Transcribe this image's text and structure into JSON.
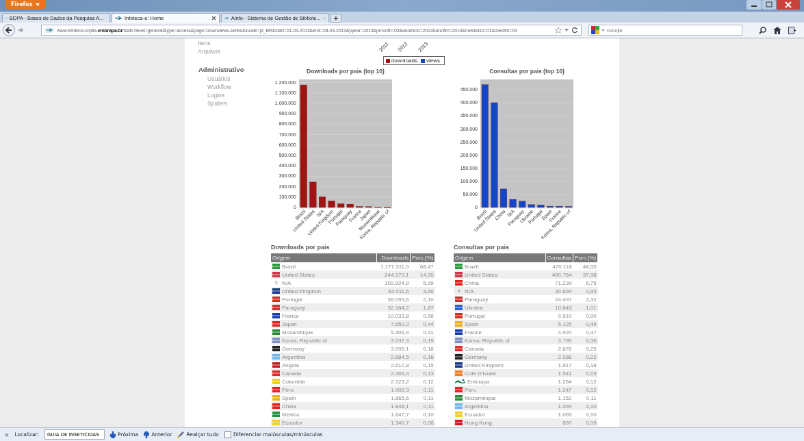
{
  "browser": {
    "menu_button": "Firefox",
    "tabs": [
      {
        "title": "BDPA - Bases de Dados da Pesquisa A...",
        "selected": false
      },
      {
        "title": "Infoteca-e: Home",
        "selected": true
      },
      {
        "title": "Ainfo - Sistema de Gestão de Bibliote...",
        "selected": false
      }
    ],
    "new_tab": "+",
    "url": "www.infoteca.cnptia.**embrapa.br**/stats?level=general&type=access&page=downviews-series&locale=pt_BR&start=01-03-2013&end=28-03-2013&pyear=2013&pmonth=03&anoinicio=2013&anofim=2013&mesinicio=01&mesfim=03",
    "search": {
      "placeholder": "Google"
    }
  },
  "sidebar": {
    "top_items": [
      "Itens",
      "Arquivos"
    ],
    "sections": [
      {
        "title": "Administrativo",
        "items": [
          "Usuários",
          "Workflow",
          "Logins",
          "Spiders"
        ]
      }
    ]
  },
  "timeline_labels": [
    "2011",
    "2012",
    "2013"
  ],
  "charts": [
    {
      "chart_data": {
        "type": "bar",
        "title": "Downloads por pais (top 10)",
        "categories": [
          "Brazil",
          "United States",
          "N/A",
          "United Kingdom",
          "Portugal",
          "Paraguay",
          "France",
          "Japan",
          "Mozambique",
          "Korea, Republic of"
        ],
        "series": [
          {
            "name": "downloads",
            "color": "#a01414",
            "values": [
              1177000,
              244000,
              103000,
              63000,
              36000,
              32000,
              10000,
              8000,
              5000,
              3000
            ]
          }
        ],
        "ylim": [
          0,
          1230000
        ],
        "grid": true,
        "yticks": [
          {
            "value": 0,
            "label": "0"
          },
          {
            "value": 100000,
            "label": "100.000"
          },
          {
            "value": 200000,
            "label": "200.000"
          },
          {
            "value": 300000,
            "label": "300.000"
          },
          {
            "value": 400000,
            "label": "400.000"
          },
          {
            "value": 500000,
            "label": "500.000"
          },
          {
            "value": 600000,
            "label": "600.000"
          },
          {
            "value": 700000,
            "label": "700.000"
          },
          {
            "value": 800000,
            "label": "800.000"
          },
          {
            "value": 900000,
            "label": "900.000"
          },
          {
            "value": 1000000,
            "label": "1.000.000"
          },
          {
            "value": 1100000,
            "label": "1.100.000"
          },
          {
            "value": 1200000,
            "label": "1.200.000"
          }
        ]
      }
    },
    {
      "chart_data": {
        "type": "bar",
        "title": "Consultas por pais (top 10)",
        "categories": [
          "Brazil",
          "United States",
          "China",
          "N/A",
          "Paraguay",
          "Ukraine",
          "Portugal",
          "Spain",
          "France",
          "Korea, Republic of"
        ],
        "series": [
          {
            "name": "views",
            "color": "#1446c8",
            "values": [
              470000,
              401000,
              71000,
              31000,
              24000,
              11000,
              10000,
              5000,
              5000,
              4000
            ]
          }
        ],
        "ylim": [
          0,
          490000
        ],
        "grid": true,
        "yticks": [
          {
            "value": 0,
            "label": "0"
          },
          {
            "value": 50000,
            "label": "50.000"
          },
          {
            "value": 100000,
            "label": "100.000"
          },
          {
            "value": 150000,
            "label": "150.000"
          },
          {
            "value": 200000,
            "label": "200.000"
          },
          {
            "value": 250000,
            "label": "250.000"
          },
          {
            "value": 300000,
            "label": "300.000"
          },
          {
            "value": 350000,
            "label": "350.000"
          },
          {
            "value": 400000,
            "label": "400.000"
          },
          {
            "value": 450000,
            "label": "450.000"
          }
        ]
      }
    }
  ],
  "tables": [
    {
      "title": "Downloads por pais",
      "columns": [
        "Origem",
        "Downloads",
        "Porc.(%)"
      ],
      "rows": [
        {
          "kind": "flag",
          "color": "#2a9a3a",
          "country": "Brazil",
          "value": "1.177.311,5",
          "percent": "68,47"
        },
        {
          "kind": "flag",
          "color": "#c83a4a",
          "country": "United States",
          "value": "244.170,1",
          "percent": "14,20"
        },
        {
          "kind": "unknown",
          "symbol": "?",
          "country": "N/A",
          "value": "102.924,9",
          "percent": "5,99"
        },
        {
          "kind": "flag",
          "color": "#1a3a8a",
          "country": "United Kingdom",
          "value": "63.011,6",
          "percent": "3,66"
        },
        {
          "kind": "flag",
          "color": "#d03020",
          "country": "Portugal",
          "value": "36.095,6",
          "percent": "2,10"
        },
        {
          "kind": "flag",
          "color": "#d03030",
          "country": "Paraguay",
          "value": "32.184,2",
          "percent": "1,87"
        },
        {
          "kind": "flag",
          "color": "#1a3ab0",
          "country": "France",
          "value": "10.033,8",
          "percent": "0,58"
        },
        {
          "kind": "flag",
          "color": "#e02020",
          "country": "Japan",
          "value": "7.650,3",
          "percent": "0,44"
        },
        {
          "kind": "flag",
          "color": "#2a8a3a",
          "country": "Mozambique",
          "value": "5.306,9",
          "percent": "0,31"
        },
        {
          "kind": "flag",
          "color": "#8090c0",
          "country": "Korea, Republic of",
          "value": "3.237,3",
          "percent": "0,19"
        },
        {
          "kind": "flag",
          "color": "#202020",
          "country": "Germany",
          "value": "3.095,1",
          "percent": "0,18"
        },
        {
          "kind": "flag",
          "color": "#70b8e8",
          "country": "Argentina",
          "value": "2.684,5",
          "percent": "0,16"
        },
        {
          "kind": "flag",
          "color": "#c02020",
          "country": "Angola",
          "value": "2.612,8",
          "percent": "0,15"
        },
        {
          "kind": "flag",
          "color": "#e02828",
          "country": "Canada",
          "value": "2.266,4",
          "percent": "0,13"
        },
        {
          "kind": "flag",
          "color": "#f0d020",
          "country": "Colombia",
          "value": "2.123,2",
          "percent": "0,12"
        },
        {
          "kind": "flag",
          "color": "#e02424",
          "country": "Peru",
          "value": "1.902,3",
          "percent": "0,11"
        },
        {
          "kind": "flag",
          "color": "#e8b020",
          "country": "Spain",
          "value": "1.865,6",
          "percent": "0,11"
        },
        {
          "kind": "flag",
          "color": "#e01c1c",
          "country": "China",
          "value": "1.848,1",
          "percent": "0,11"
        },
        {
          "kind": "flag",
          "color": "#2a8a40",
          "country": "Mexico",
          "value": "1.647,7",
          "percent": "0,10"
        },
        {
          "kind": "flag",
          "color": "#f0d028",
          "country": "Ecuador",
          "value": "1.340,7",
          "percent": "0,08"
        }
      ]
    },
    {
      "title": "Consultas por pais",
      "columns": [
        "Origem",
        "Consultas",
        "Porc.(%)"
      ],
      "rows": [
        {
          "kind": "flag",
          "color": "#2a9a3a",
          "country": "Brazil",
          "value": "470.118",
          "percent": "44,55"
        },
        {
          "kind": "flag",
          "color": "#c83a4a",
          "country": "United States",
          "value": "400.764",
          "percent": "37,98"
        },
        {
          "kind": "flag",
          "color": "#e01c1c",
          "country": "China",
          "value": "71.239",
          "percent": "6,75"
        },
        {
          "kind": "unknown",
          "symbol": "?",
          "country": "N/A",
          "value": "30.894",
          "percent": "2,93"
        },
        {
          "kind": "flag",
          "color": "#d03030",
          "country": "Paraguay",
          "value": "24.497",
          "percent": "2,32"
        },
        {
          "kind": "flag",
          "color": "#2a60d0",
          "country": "Ukraine",
          "value": "10.643",
          "percent": "1,01"
        },
        {
          "kind": "flag",
          "color": "#d03020",
          "country": "Portugal",
          "value": "9.510",
          "percent": "0,90"
        },
        {
          "kind": "flag",
          "color": "#e8b020",
          "country": "Spain",
          "value": "5.125",
          "percent": "0,49"
        },
        {
          "kind": "flag",
          "color": "#1a3ab0",
          "country": "France",
          "value": "4.920",
          "percent": "0,47"
        },
        {
          "kind": "flag",
          "color": "#8090c0",
          "country": "Korea, Republic of",
          "value": "3.795",
          "percent": "0,36"
        },
        {
          "kind": "flag",
          "color": "#e02828",
          "country": "Canada",
          "value": "2.678",
          "percent": "0,25"
        },
        {
          "kind": "flag",
          "color": "#202020",
          "country": "Germany",
          "value": "2.288",
          "percent": "0,22"
        },
        {
          "kind": "flag",
          "color": "#1a3a8a",
          "country": "United Kingdom",
          "value": "1.917",
          "percent": "0,18"
        },
        {
          "kind": "flag",
          "color": "#f08020",
          "country": "Cote D'Ivoire",
          "value": "1.541",
          "percent": "0,15"
        },
        {
          "kind": "logo",
          "country": "Embrapa",
          "value": "1.264",
          "percent": "0,12"
        },
        {
          "kind": "flag",
          "color": "#e02424",
          "country": "Peru",
          "value": "1.247",
          "percent": "0,12"
        },
        {
          "kind": "flag",
          "color": "#2a8a3a",
          "country": "Mozambique",
          "value": "1.152",
          "percent": "0,11"
        },
        {
          "kind": "flag",
          "color": "#70b8e8",
          "country": "Argentina",
          "value": "1.094",
          "percent": "0,10"
        },
        {
          "kind": "flag",
          "color": "#f0d028",
          "country": "Ecuador",
          "value": "1.065",
          "percent": "0,10"
        },
        {
          "kind": "flag",
          "color": "#d81818",
          "country": "Hong Kong",
          "value": "897",
          "percent": "0,09"
        }
      ]
    }
  ],
  "find_bar": {
    "close": "×",
    "label": "Localizar:",
    "value": "GUIA DE INSETICIDAS",
    "next": "Próxima",
    "previous": "Anterior",
    "highlight": "Realçar tudo",
    "case_checkbox": {
      "label": "Diferenciar maiúsculas/minúsculas",
      "checked": false
    }
  }
}
